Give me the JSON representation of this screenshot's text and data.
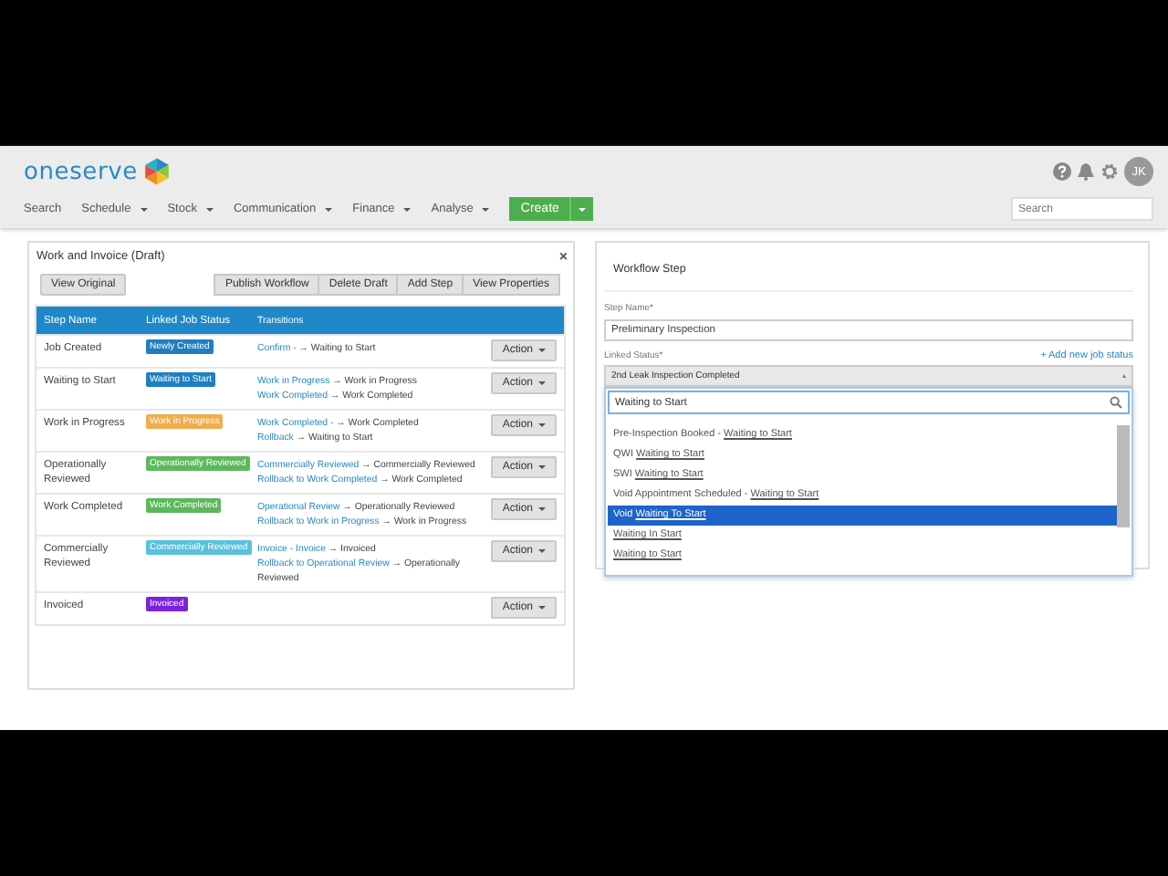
{
  "header": {
    "logo": "oneserve",
    "nav": [
      {
        "label": "Search",
        "dropdown": false
      },
      {
        "label": "Schedule",
        "dropdown": true
      },
      {
        "label": "Stock",
        "dropdown": true
      },
      {
        "label": "Communication",
        "dropdown": true
      },
      {
        "label": "Finance",
        "dropdown": true
      },
      {
        "label": "Analyse",
        "dropdown": true
      }
    ],
    "create": "Create",
    "avatar": "JK",
    "search": {
      "placeholder": "Search"
    }
  },
  "workflow": {
    "title": "Work and Invoice (Draft)",
    "close": "×",
    "view_original": "View Original",
    "toolbar": [
      "Publish Workflow",
      "Delete Draft",
      "Add Step",
      "View Properties"
    ],
    "columns": [
      "Step Name",
      "Linked Job Status",
      "Transitions"
    ],
    "steps": [
      {
        "name": "Job Created",
        "status": {
          "label": "Newly Created",
          "color": "#1f7fc0"
        },
        "transitions": [
          {
            "link": "Confirm -",
            "target": "→ Waiting to Start"
          }
        ],
        "action": "Action"
      },
      {
        "name": "Waiting to Start",
        "status": {
          "label": "Waiting to Start",
          "color": "#1f7fc0"
        },
        "transitions": [
          {
            "link": "Work in Progress",
            "target": "→ Work in Progress"
          },
          {
            "link": "Work Completed",
            "target": "→ Work Completed"
          }
        ],
        "action": "Action"
      },
      {
        "name": "Work in Progress",
        "status": {
          "label": "Work in Progress",
          "color": "#f0ad4e"
        },
        "transitions": [
          {
            "link": "Work Completed -",
            "target": "→ Work Completed"
          },
          {
            "link": "Rollback",
            "target": "→ Waiting to Start"
          }
        ],
        "action": "Action"
      },
      {
        "name": "Operationally Reviewed",
        "status": {
          "label": "Operationally Reviewed",
          "color": "#5cb85c"
        },
        "transitions": [
          {
            "link": "Commercially Reviewed",
            "target": "→ Commercially Reviewed"
          },
          {
            "link": "Rollback to Work Completed",
            "target": "→ Work Completed"
          }
        ],
        "action": "Action"
      },
      {
        "name": "Work Completed",
        "status": {
          "label": "Work Completed",
          "color": "#5cb85c"
        },
        "transitions": [
          {
            "link": "Operational Review",
            "target": "→ Operationally Reviewed"
          },
          {
            "link": "Rollback to Work in Progress",
            "target": "→ Work in Progress"
          }
        ],
        "action": "Action"
      },
      {
        "name": "Commercially Reviewed",
        "status": {
          "label": "Commercially Reviewed",
          "color": "#5bc0de"
        },
        "transitions": [
          {
            "link": "Invoice - Invoice",
            "target": "→ Invoiced"
          },
          {
            "link": "Rollback to Operational Review",
            "target": "→ Operationally Reviewed"
          }
        ],
        "action": "Action"
      },
      {
        "name": "Invoiced",
        "status": {
          "label": "Invoiced",
          "color": "#7b22e0"
        },
        "action": "Action"
      }
    ]
  },
  "step_panel": {
    "title": "Workflow Step",
    "step_name_label": "Step Name*",
    "step_name": "Preliminary Inspection",
    "linked_status_label": "Linked Status*",
    "add_status": "+ Add new job status",
    "linked_status": "2nd Leak Inspection Completed",
    "filter": "Waiting to Start",
    "options": [
      {
        "prefix": "Pre-Inspection Booked - ",
        "match": "Waiting to Start",
        "selected": false
      },
      {
        "prefix": "QWI ",
        "match": "Waiting to Start",
        "selected": false
      },
      {
        "prefix": "SWI ",
        "match": "Waiting to Start",
        "selected": false
      },
      {
        "prefix": "Void Appointment Scheduled - ",
        "match": "Waiting to Start",
        "selected": false
      },
      {
        "prefix": "Void ",
        "match": "Waiting To Start",
        "selected": true
      },
      {
        "match": "Waiting In Start",
        "selected": false
      },
      {
        "match": "Waiting to Start",
        "selected": false
      }
    ]
  }
}
